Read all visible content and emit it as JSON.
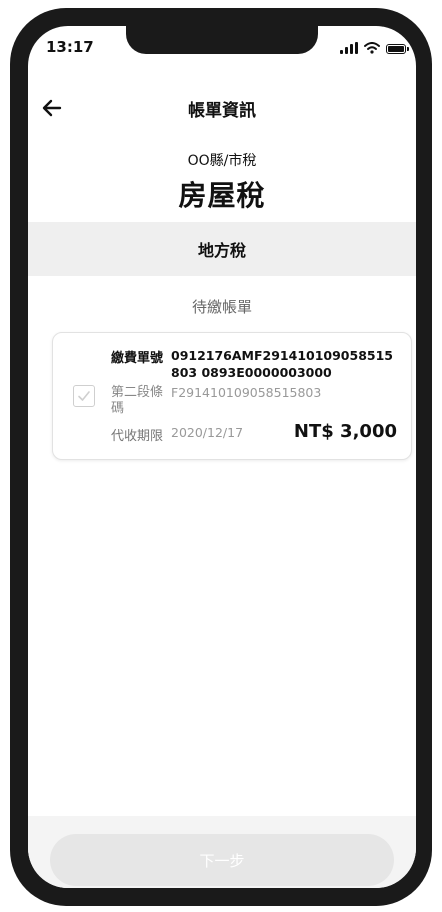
{
  "status_bar": {
    "time": "13:17"
  },
  "header": {
    "title": "帳單資訊"
  },
  "tax": {
    "issuer": "OO縣/市稅",
    "name": "房屋稅"
  },
  "section": {
    "label": "地方稅"
  },
  "pending_label": "待繳帳單",
  "bill": {
    "checked": false,
    "payment_no_label": "繳費單號",
    "payment_no": "0912176AMF291410109058515803 0893E0000003000",
    "barcode2_label": "第二段條碼",
    "barcode2": "F291410109058515803",
    "due_label": "代收期限",
    "due_date": "2020/12/17",
    "amount": "NT$ 3,000"
  },
  "footer": {
    "next_label": "下一步"
  },
  "colors": {
    "accent_disabled": "#e6e6e6",
    "section_bg": "#efefef"
  },
  "icons": [
    "back-arrow-icon",
    "signal-icon",
    "wifi-icon",
    "battery-icon",
    "checkmark-icon"
  ]
}
